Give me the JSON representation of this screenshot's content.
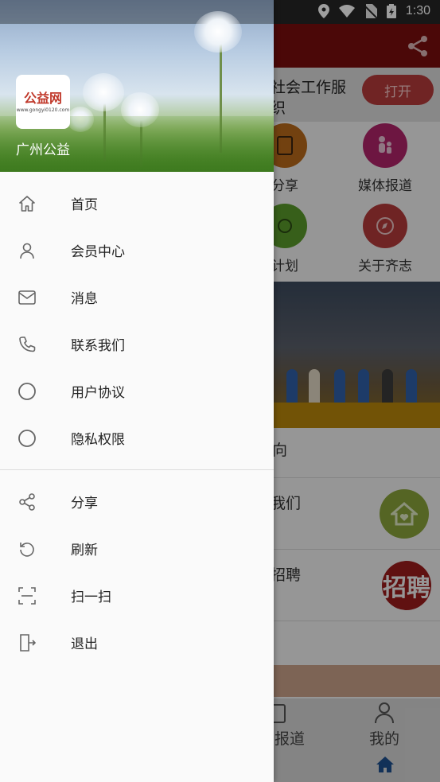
{
  "status_bar": {
    "time": "1:30",
    "icons": [
      "location-icon",
      "wifi-icon",
      "no-sim-icon",
      "battery-icon"
    ]
  },
  "background_app": {
    "banner_text": "社会工作服\n织",
    "open_button": "打开",
    "grid": [
      {
        "label": "分享",
        "icon": "share-doc-icon",
        "color": "#b86a1a"
      },
      {
        "label": "媒体报道",
        "icon": "family-icon",
        "color": "#b0246a"
      },
      {
        "label": "计划",
        "icon": "eye-icon",
        "color": "#5a9a2a"
      },
      {
        "label": "关于齐志",
        "icon": "compass-icon",
        "color": "#b43a3a"
      }
    ],
    "section_partial_1": "向",
    "section_partial_2": "我们",
    "section_partial_3": "招聘",
    "hire_badge": "招聘",
    "bottom_nav": [
      {
        "label": "报道",
        "icon": "news-icon"
      },
      {
        "label": "我的",
        "icon": "person-icon"
      }
    ]
  },
  "drawer": {
    "app_name": "广州公益",
    "logo_text": "公益网",
    "logo_url": "www.gongyi0120.com",
    "menu_primary": [
      {
        "label": "首页",
        "icon": "home-icon"
      },
      {
        "label": "会员中心",
        "icon": "user-icon"
      },
      {
        "label": "消息",
        "icon": "mail-icon"
      },
      {
        "label": "联系我们",
        "icon": "phone-icon"
      },
      {
        "label": "用户协议",
        "icon": "circle-icon"
      },
      {
        "label": "隐私权限",
        "icon": "circle-icon"
      }
    ],
    "menu_secondary": [
      {
        "label": "分享",
        "icon": "share-icon"
      },
      {
        "label": "刷新",
        "icon": "refresh-icon"
      },
      {
        "label": "扫一扫",
        "icon": "scan-icon"
      },
      {
        "label": "退出",
        "icon": "exit-icon"
      }
    ]
  },
  "colors": {
    "toolbar": "#d40000",
    "accent_blue": "#1e63b8"
  }
}
